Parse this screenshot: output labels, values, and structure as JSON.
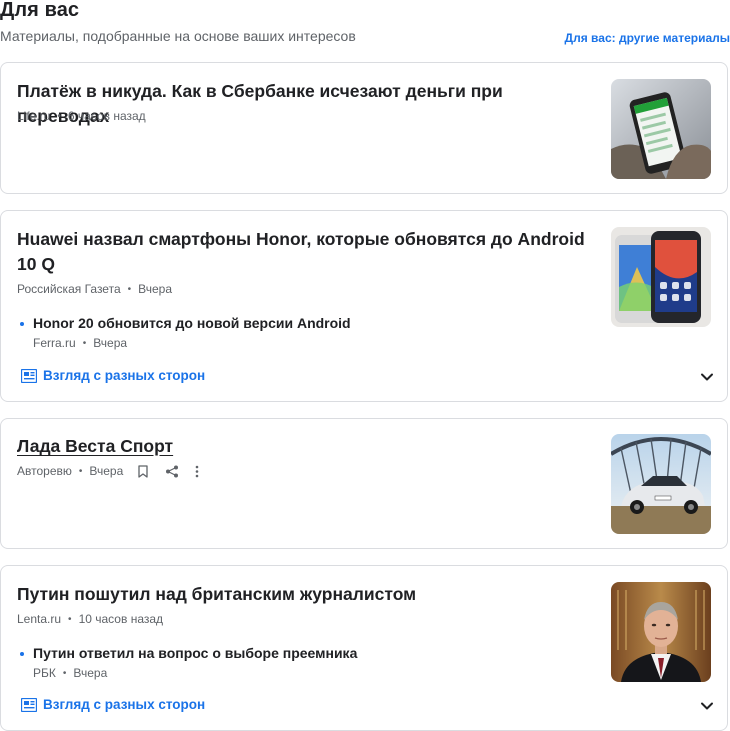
{
  "section": {
    "title": "Для вас",
    "subtitle": "Материалы, подобранные на основе ваших интересов",
    "more_link": "Для вас: другие материалы"
  },
  "cards": [
    {
      "title": "Платёж в никуда. Как в Сбербанке исчезают деньги при переводах",
      "source": "Life.ru",
      "time": "6 часов назад",
      "thumb_icon": "phone-banking-photo"
    },
    {
      "title": "Huawei назвал смартфоны Honor, которые обновятся до Android 10 Q",
      "source": "Российская Газета",
      "time": "Вчера",
      "thumb_icon": "honor-smartphones-photo",
      "related": {
        "title": "Honor 20 обновится до новой версии Android",
        "source": "Ferra.ru",
        "time": "Вчера"
      },
      "coverage_label": "Взгляд с разных сторон"
    },
    {
      "title": "Лада Веста Спорт",
      "source": "Авторевю",
      "time": "Вчера",
      "thumb_icon": "lada-car-on-bridge-photo"
    },
    {
      "title": "Путин пошутил над британским журналистом",
      "source": "Lenta.ru",
      "time": "10 часов назад",
      "thumb_icon": "putin-portrait-photo",
      "related": {
        "title": "Путин ответил на вопрос о выборе преемника",
        "source": "РБК",
        "time": "Вчера"
      },
      "coverage_label": "Взгляд с разных сторон"
    }
  ],
  "colors": {
    "accent": "#1a73e8",
    "text": "#202124",
    "meta": "#5f6368",
    "border": "#dadce0"
  }
}
